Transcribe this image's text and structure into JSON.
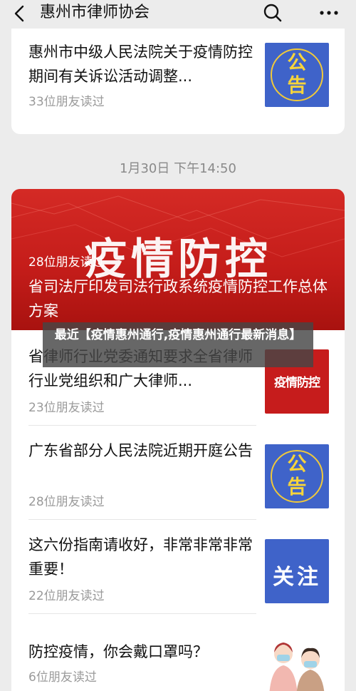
{
  "header": {
    "title": "惠州市律师协会",
    "back_icon": "back-arrow-icon",
    "search_icon": "search-icon",
    "more_icon": "more-icon"
  },
  "articles_top": [
    {
      "title": "惠州市中级人民法院关于疫情防控期间有关诉讼活动调整...",
      "meta": "33位朋友读过",
      "thumb": {
        "glyph1": "公",
        "glyph2": "告"
      }
    }
  ],
  "date_label": "1月30日 下午14:50",
  "hero": {
    "background_text": "疫情防控",
    "meta": "28位朋友读过",
    "title": "省司法厅印发司法行政系统疫情防控工作总体方案"
  },
  "articles": [
    {
      "title": "省律师行业党委通知要求全省律师行业党组织和广大律师...",
      "meta": "23位朋友读过",
      "thumb": {
        "glyph": "疫情防控"
      }
    },
    {
      "title": "广东省部分人民法院近期开庭公告",
      "meta": "28位朋友读过",
      "thumb": {
        "glyph1": "公",
        "glyph2": "告"
      }
    },
    {
      "title": "这六份指南请收好，非常非常非常重要！",
      "meta": "22位朋友读过",
      "thumb": {
        "glyph": "关注"
      }
    },
    {
      "title": "防控疫情，你会戴口罩吗？",
      "meta": "6位朋友读过",
      "thumb": {
        "icon": "masked-people-icon"
      }
    }
  ],
  "overlay": {
    "text": "最近【疫情惠州通行,疫情惠州通行最新消息】"
  },
  "colors": {
    "background": "#ececec",
    "notice_blue": "#3f63c9",
    "notice_yellow": "#f6d43b",
    "hero_red": "#c51d1a",
    "meta_gray": "#9a9a9a"
  }
}
